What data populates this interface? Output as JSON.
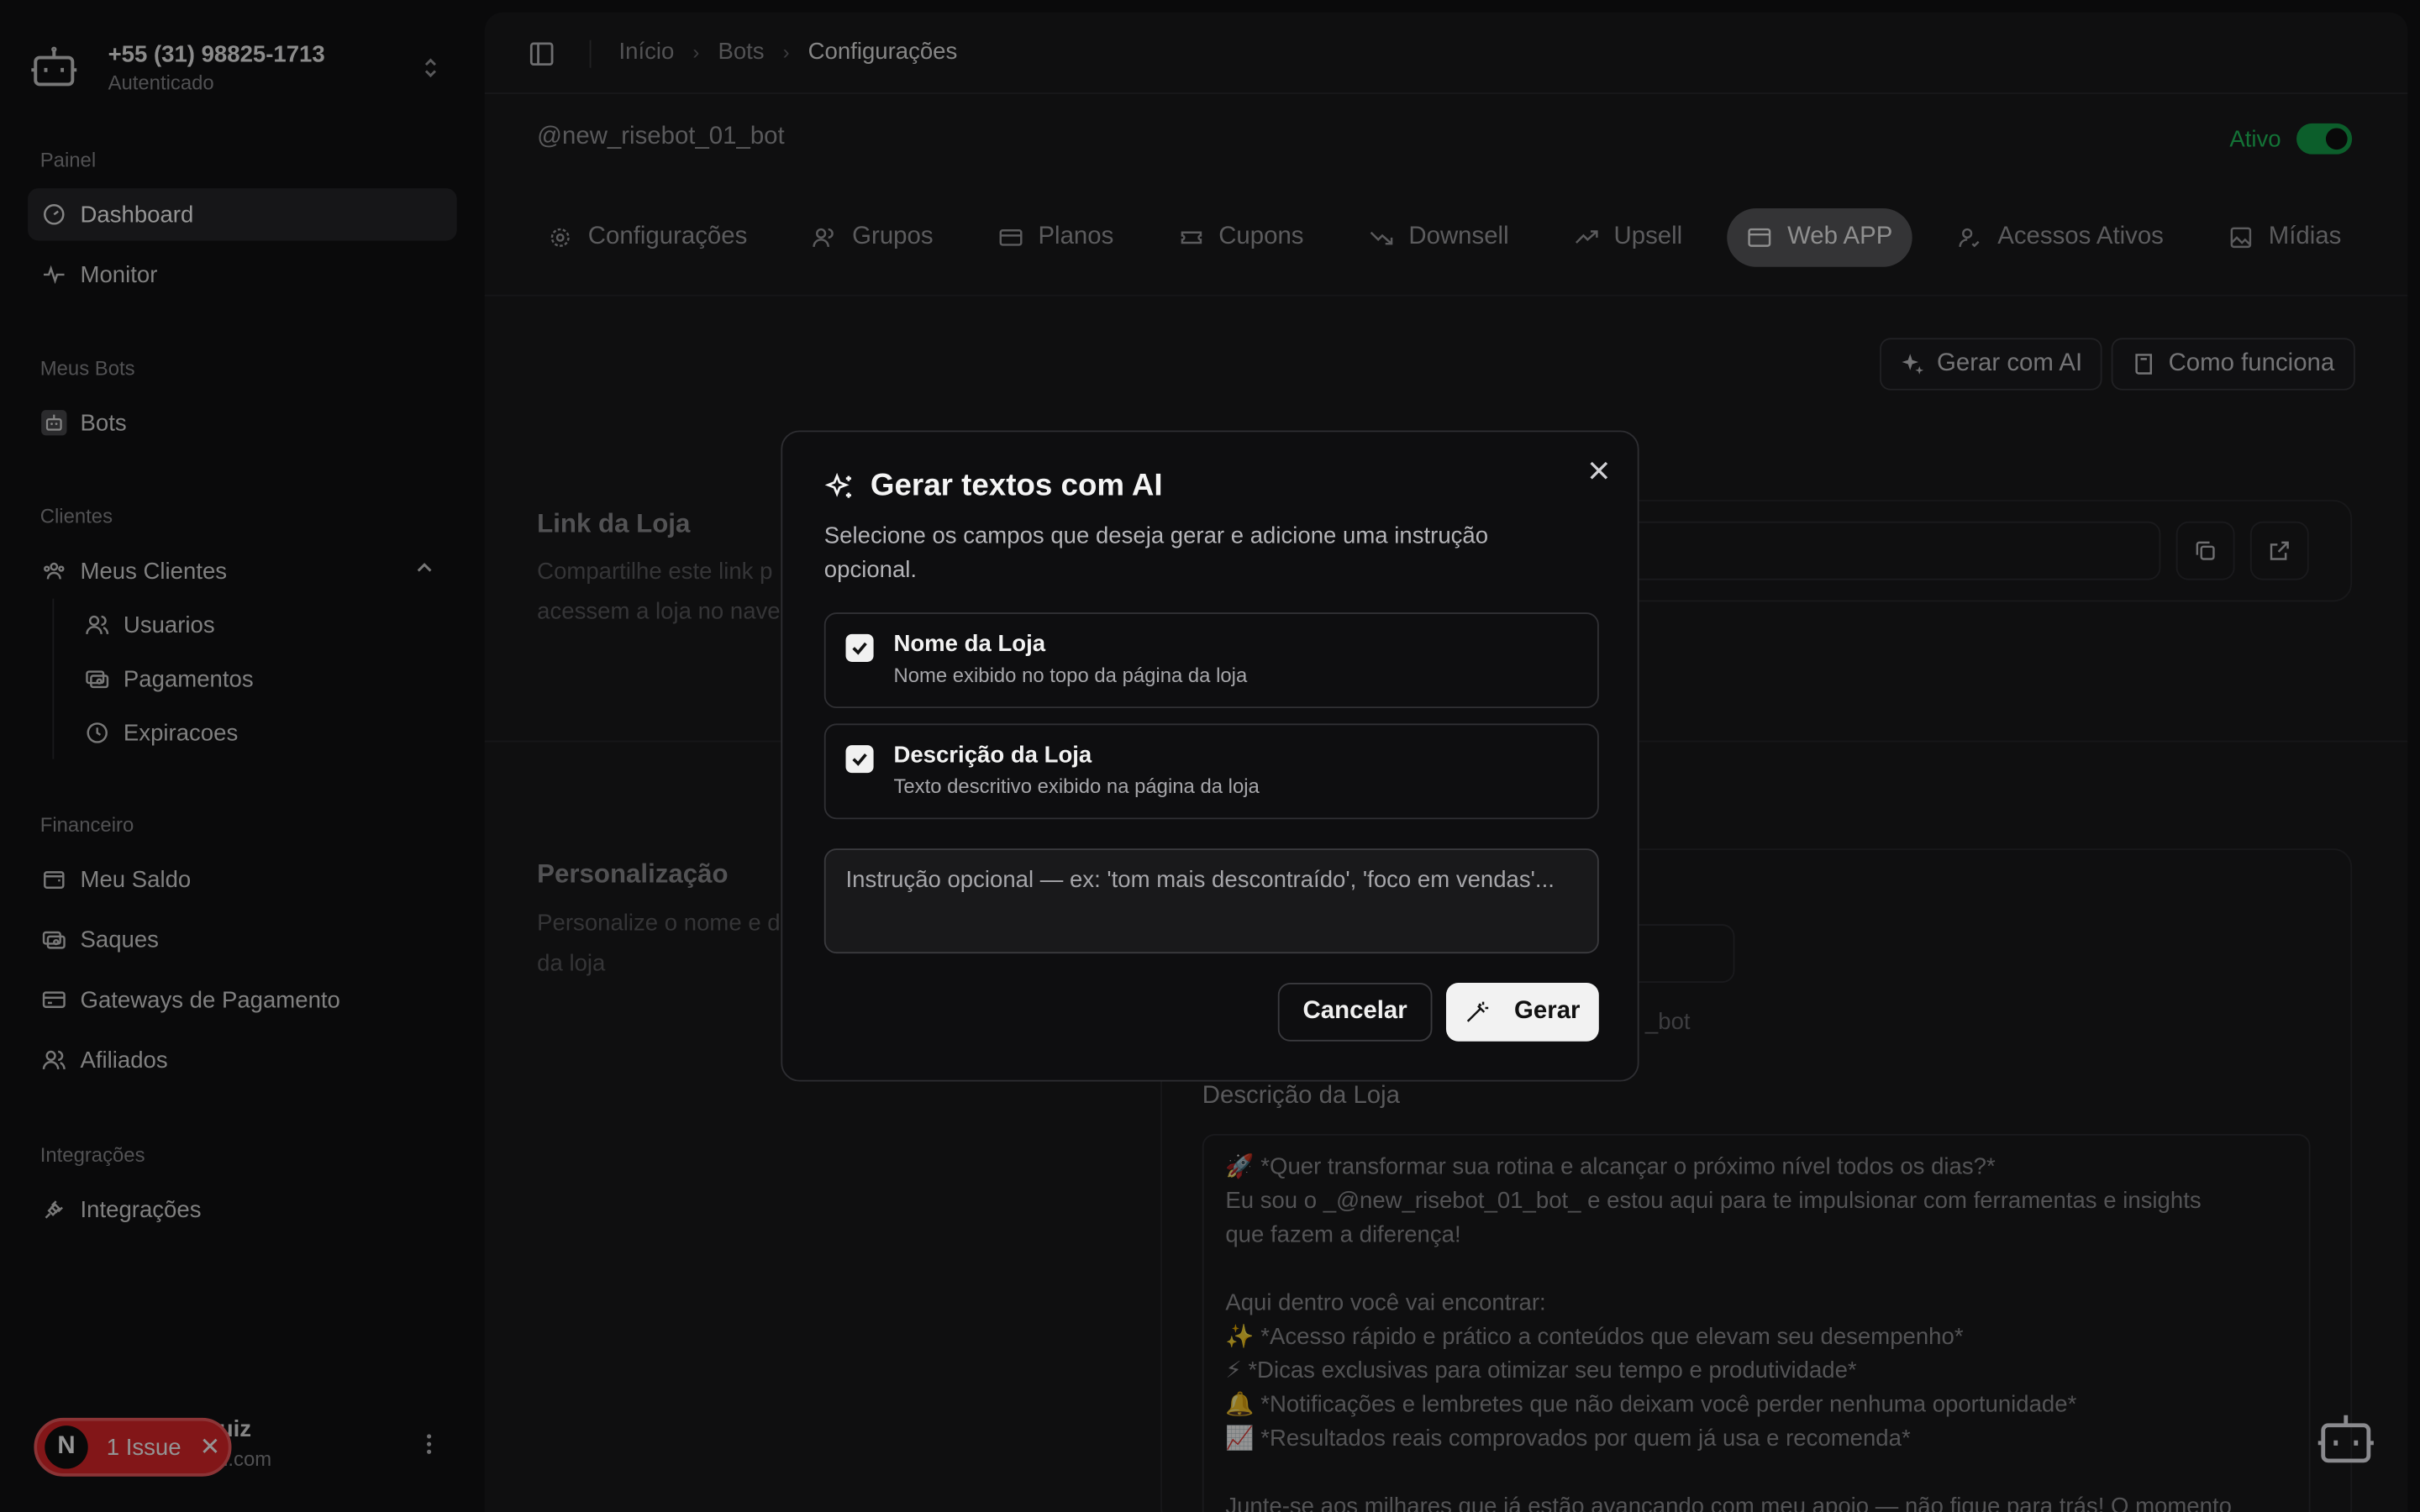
{
  "account": {
    "phone": "+55 (31) 98825-1713",
    "status": "Autenticado"
  },
  "sidebar": {
    "groups": {
      "painel": "Painel",
      "meus_bots": "Meus Bots",
      "clientes": "Clientes",
      "financeiro": "Financeiro",
      "integracoes": "Integrações"
    },
    "items": {
      "dashboard": "Dashboard",
      "monitor": "Monitor",
      "bots": "Bots",
      "meus_clientes": "Meus Clientes",
      "usuarios": "Usuarios",
      "pagamentos": "Pagamentos",
      "expiracoes": "Expiracoes",
      "meu_saldo": "Meu Saldo",
      "saques": "Saques",
      "gateways": "Gateways de Pagamento",
      "afiliados": "Afiliados",
      "integracoes": "Integrações"
    },
    "user_name_partial": "uiz",
    "user_email_partial": "il.com"
  },
  "issue_badge": {
    "letter": "N",
    "label": "1 Issue"
  },
  "breadcrumb": {
    "home": "Início",
    "bots": "Bots",
    "current": "Configurações"
  },
  "bot": {
    "handle": "@new_risebot_01_bot",
    "status_label": "Ativo"
  },
  "tabs": {
    "configuracoes": "Configurações",
    "grupos": "Grupos",
    "planos": "Planos",
    "cupons": "Cupons",
    "downsell": "Downsell",
    "upsell": "Upsell",
    "webapp": "Web APP",
    "acessos": "Acessos Ativos",
    "midias": "Mídias"
  },
  "actions": {
    "gerar_ai": "Gerar com AI",
    "como_funciona": "Como funciona"
  },
  "sections": {
    "link": {
      "title": "Link da Loja",
      "desc": "Compartilhe este link p acessem a loja no nave"
    },
    "pers": {
      "title": "Personalização",
      "desc": "Personalize o nome e d da loja"
    }
  },
  "store": {
    "bot_suffix": "_bot",
    "desc_label": "Descrição da Loja",
    "desc_lines": [
      "🚀  *Quer transformar sua rotina e alcançar o próximo nível todos os dias?*",
      "Eu sou o _@new_risebot_01_bot_ e estou aqui para te impulsionar com ferramentas e insights",
      "que fazem a diferença!",
      "",
      "Aqui dentro você vai encontrar:",
      "✨  *Acesso rápido e prático a conteúdos que elevam seu desempenho*",
      "⚡  *Dicas exclusivas para otimizar seu tempo e produtividade*",
      "🔔  *Notificações e lembretes que não deixam você perder nenhuma oportunidade*",
      "📈  *Resultados reais comprovados por quem já usa e recomenda*",
      "",
      "Junte-se aos milhares que já estão avançando com meu apoio — não fique para trás! O momento"
    ]
  },
  "modal": {
    "title": "Gerar textos com AI",
    "desc": "Selecione os campos que deseja gerar e adicione uma instrução opcional.",
    "options": [
      {
        "title": "Nome da Loja",
        "sub": "Nome exibido no topo da página da loja",
        "checked": true
      },
      {
        "title": "Descrição da Loja",
        "sub": "Texto descritivo exibido na página da loja",
        "checked": true
      }
    ],
    "instruction_placeholder": "Instrução opcional — ex: 'tom mais descontraído', 'foco em vendas'...",
    "cancel": "Cancelar",
    "submit": "Gerar"
  },
  "colors": {
    "accent_green": "#22c55e",
    "issue_red": "#e0262a",
    "active_tab": "#5a5a5e"
  }
}
